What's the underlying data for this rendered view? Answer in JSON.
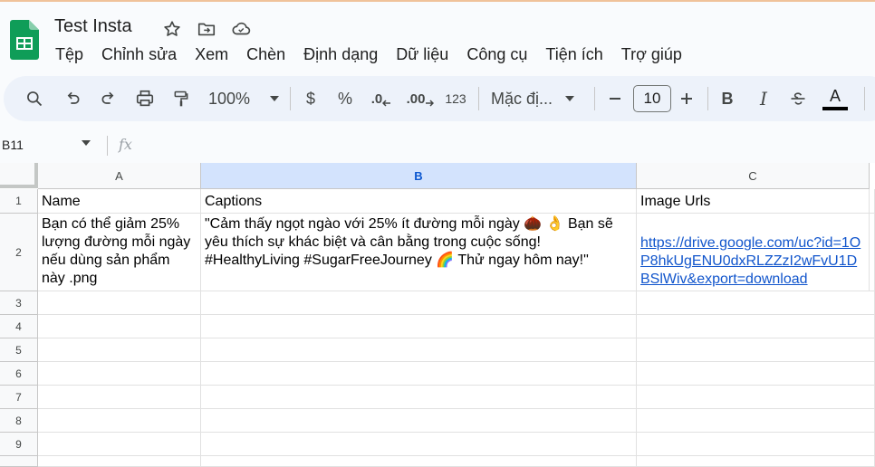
{
  "app": {
    "title": "Test Insta",
    "menu": [
      "Tệp",
      "Chỉnh sửa",
      "Xem",
      "Chèn",
      "Định dạng",
      "Dữ liệu",
      "Công cụ",
      "Tiện ích",
      "Trợ giúp"
    ]
  },
  "toolbar": {
    "zoom": "100%",
    "currency": "$",
    "percent": "%",
    "dec_decrease": ".0",
    "dec_increase": ".00",
    "number_format": "123",
    "font": "Mặc đị...",
    "font_size": "10",
    "bold": "B",
    "italic": "I",
    "text_color_glyph": "A"
  },
  "formula_bar": {
    "name_box": "B11",
    "fx": "fx"
  },
  "grid": {
    "columns": [
      "A",
      "B",
      "C"
    ],
    "selected_column": "B",
    "rows": [
      "1",
      "2",
      "3",
      "4",
      "5",
      "6",
      "7",
      "8",
      "9"
    ],
    "cells": {
      "A1": "Name",
      "B1": "Captions",
      "C1": "Image Urls",
      "A2": "Bạn có thể giảm 25% lượng đường mỗi ngày nếu dùng sản phẩm này .png",
      "B2": "\"Cảm thấy ngọt ngào với 25% ít đường mỗi ngày 🌰 👌 Bạn sẽ yêu thích sự khác biệt và cân bằng trong cuộc sống! #HealthyLiving #SugarFreeJourney 🌈 Thử ngay hôm nay!\"",
      "C2": "https://drive.google.com/uc?id=1OP8hkUgENU0dxRLZZzI2wFvU1DBSlWiv&export=download"
    }
  },
  "colors": {
    "accent": "#0b57d0",
    "sheets_green": "#0f9d58",
    "link": "#1155cc",
    "toolbar_bg": "#edf2fa"
  }
}
